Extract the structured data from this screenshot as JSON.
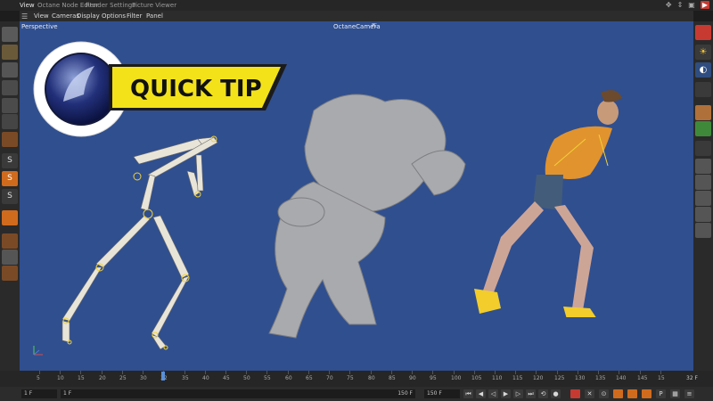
{
  "window": {
    "tabs": [
      "View",
      "Octane Node Editor",
      "Render Settings",
      "Picture Viewer"
    ],
    "active_tab": "View"
  },
  "menubar": {
    "items": [
      "View",
      "Cameras",
      "Display",
      "Options",
      "Filter",
      "Panel"
    ]
  },
  "viewport": {
    "view_name": "Perspective",
    "camera_name": "OctaneCamera",
    "background": "#304f8f"
  },
  "overlay": {
    "headline": "QUICK TIP",
    "banner_color": "#f3e21a"
  },
  "timeline": {
    "ticks": [
      "5",
      "10",
      "15",
      "20",
      "25",
      "30",
      "32",
      "35",
      "40",
      "45",
      "50",
      "55",
      "60",
      "65",
      "70",
      "75",
      "80",
      "85",
      "90",
      "95",
      "100",
      "105",
      "110",
      "115",
      "120",
      "125",
      "130",
      "135",
      "140",
      "145",
      "15"
    ],
    "current_frame_label": "32 F",
    "playhead_frame": 32,
    "max_frame": 150
  },
  "transport": {
    "start_frame": "1 F",
    "preview_start": "1 F",
    "end_frame": "150 F",
    "preview_end": "150 F"
  },
  "colors": {
    "accent_red": "#c73a32",
    "accent_blue": "#5a8fd6",
    "toolbar_orange": "#d06b1e"
  }
}
